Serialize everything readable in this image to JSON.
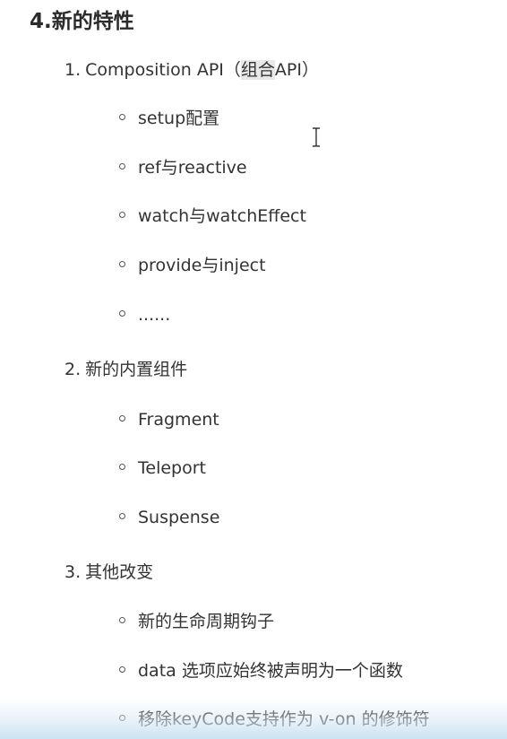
{
  "heading": "4.新的特性",
  "sections": [
    {
      "number": "1.",
      "label_main": "Composition API（",
      "label_highlight": "组合",
      "label_rest": "API）",
      "items": [
        "setup配置",
        "ref与reactive",
        "watch与watchEffect",
        "provide与inject",
        "......"
      ]
    },
    {
      "number": "2.",
      "label": "新的内置组件",
      "items": [
        "Fragment",
        "Teleport",
        "Suspense"
      ]
    },
    {
      "number": "3.",
      "label": "其他改变",
      "items": [
        "新的生命周期钩子",
        "data 选项应始终被声明为一个函数",
        "移除keyCode支持作为 v-on 的修饰符"
      ]
    }
  ]
}
